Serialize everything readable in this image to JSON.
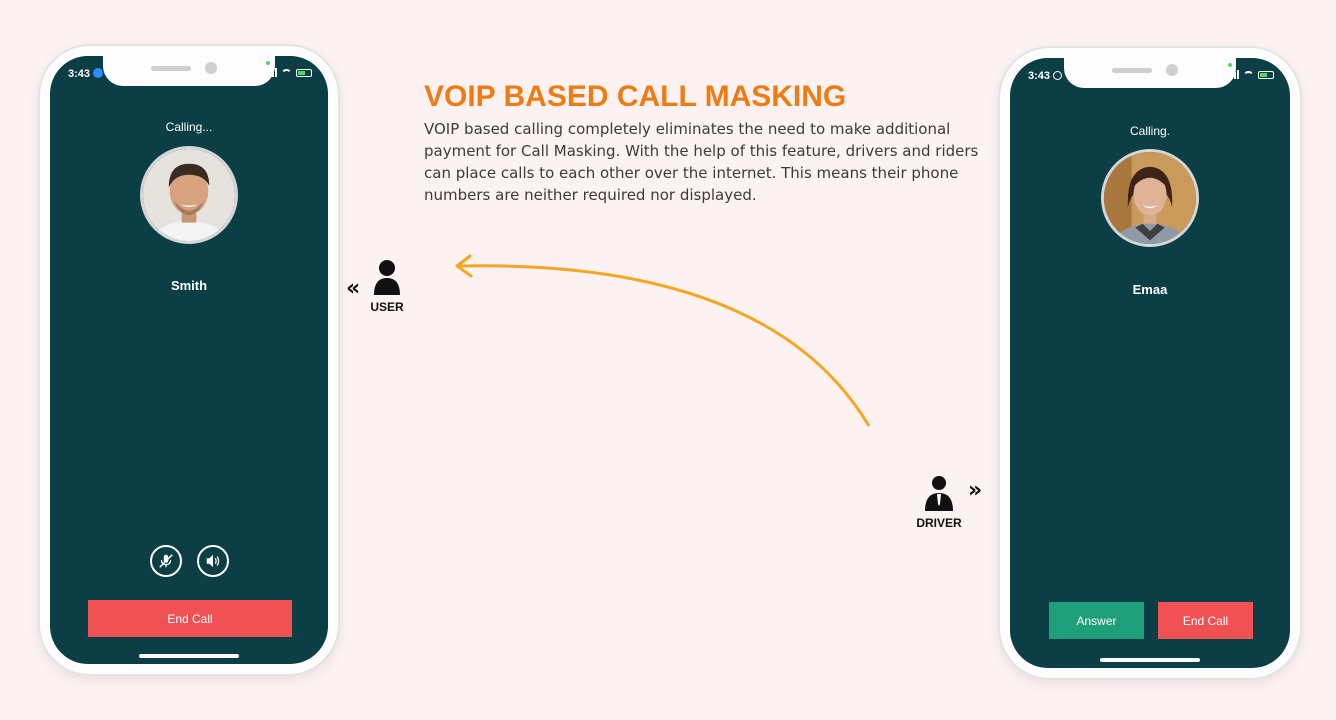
{
  "heading": "VOIP BASED CALL MASKING",
  "description": "VOIP based calling completely eliminates the need to make additional payment for Call Masking. With the help of this feature, drivers and riders can place calls to each other over the internet. This means their phone numbers are neither required nor displayed.",
  "user_role": {
    "label": "USER",
    "icon": "person-icon",
    "chevron": "«"
  },
  "driver_role": {
    "label": "DRIVER",
    "icon": "driver-icon",
    "chevron": "»"
  },
  "arrow": {
    "color": "#f5a623",
    "direction": "driver-to-user"
  },
  "left_phone": {
    "status_time": "3:43",
    "calling_text": "Calling...",
    "callee_name": "Smith",
    "mute_icon": "mic-off-icon",
    "speaker_icon": "speaker-icon",
    "end_call_label": "End Call"
  },
  "right_phone": {
    "status_time": "3:43",
    "calling_text": "Calling.",
    "callee_name": "Emaa",
    "answer_label": "Answer",
    "end_call_label": "End Call"
  },
  "colors": {
    "background": "#fcf2f1",
    "screen": "#0b3e45",
    "heading": "#f07b13",
    "end_call": "#f05152",
    "answer": "#1e9e79"
  }
}
